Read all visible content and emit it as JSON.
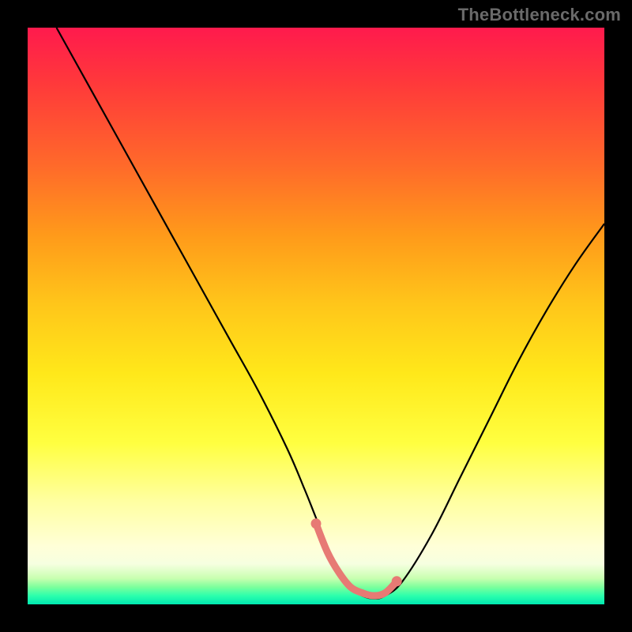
{
  "watermark": "TheBottleneck.com",
  "colors": {
    "background": "#000000",
    "gradient_top": "#ff1a4d",
    "gradient_bottom": "#00e8b0",
    "curve": "#000000",
    "highlight": "#e77a74"
  },
  "chart_data": {
    "type": "line",
    "title": "",
    "xlabel": "",
    "ylabel": "",
    "xlim": [
      0,
      100
    ],
    "ylim": [
      0,
      100
    ],
    "grid": false,
    "legend": false,
    "series": [
      {
        "name": "curve",
        "x": [
          5,
          10,
          15,
          20,
          25,
          30,
          35,
          40,
          45,
          48,
          50,
          52,
          54,
          56,
          58,
          60,
          62,
          65,
          70,
          75,
          80,
          85,
          90,
          95,
          100
        ],
        "y": [
          100,
          91,
          82,
          73,
          64,
          55,
          46,
          37,
          27,
          20,
          15,
          10,
          6,
          3,
          1.5,
          1,
          1.5,
          4,
          12,
          22,
          32,
          42,
          51,
          59,
          66
        ]
      },
      {
        "name": "highlight-segment",
        "x": [
          50,
          52,
          54,
          56,
          58,
          60,
          62,
          64
        ],
        "y": [
          14,
          9,
          5.5,
          3,
          2,
          1.5,
          2,
          4
        ]
      }
    ],
    "annotations": []
  }
}
